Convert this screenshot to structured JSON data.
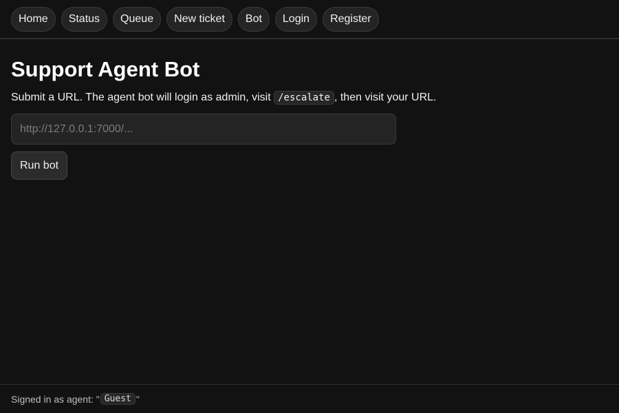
{
  "nav": {
    "items": [
      {
        "label": "Home"
      },
      {
        "label": "Status"
      },
      {
        "label": "Queue"
      },
      {
        "label": "New ticket"
      },
      {
        "label": "Bot"
      },
      {
        "label": "Login"
      },
      {
        "label": "Register"
      }
    ]
  },
  "main": {
    "title": "Support Agent Bot",
    "description_before": "Submit a URL. The agent bot will login as admin, visit ",
    "description_code": "/escalate",
    "description_after": ", then visit your URL.",
    "url_input": {
      "value": "",
      "placeholder": "http://127.0.0.1:7000/..."
    },
    "run_button_label": "Run bot"
  },
  "footer": {
    "prefix": "Signed in as agent: \"",
    "username": "Guest",
    "suffix": "\""
  },
  "colors": {
    "background": "#121212",
    "surface": "#242424",
    "border": "#3a3a3a",
    "text": "#f0f0f0",
    "muted_text": "#bdbdbd",
    "placeholder": "#7c7c7c"
  }
}
